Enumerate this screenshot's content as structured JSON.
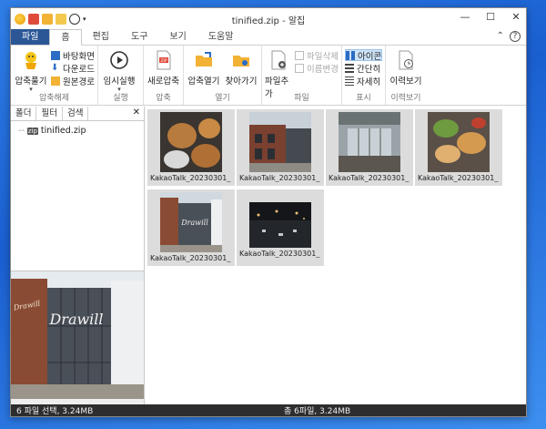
{
  "window": {
    "title": "tinified.zip - 알집"
  },
  "ribbon_tabs": [
    "파일",
    "홈",
    "편집",
    "도구",
    "보기",
    "도움말"
  ],
  "ribbon": {
    "extract": {
      "big_label": "압축풀기",
      "small": [
        "바탕화면",
        "다운로드",
        "원본경로"
      ],
      "group_label": "압축해제"
    },
    "run": {
      "big_label": "임시실행",
      "group_label": "실행"
    },
    "compress": {
      "big_label": "새로압축",
      "group_label": "압축"
    },
    "open": {
      "big1": "압축열기",
      "big2": "찾아가기",
      "group_label": "열기"
    },
    "file": {
      "big_label": "파일추가",
      "small": [
        "파일삭제",
        "이름변경"
      ],
      "group_label": "파일"
    },
    "view": {
      "small": [
        "아이콘",
        "간단히",
        "자세히"
      ],
      "group_label": "표시"
    },
    "history": {
      "big_label": "이력보기",
      "group_label": "이력보기"
    }
  },
  "left_tabs": [
    "폴더",
    "필터",
    "검색"
  ],
  "tree": {
    "root": "tinified.zip",
    "zip_tag": "zip"
  },
  "files": [
    {
      "name": "KakaoTalk_20230301_"
    },
    {
      "name": "KakaoTalk_20230301_"
    },
    {
      "name": "KakaoTalk_20230301_"
    },
    {
      "name": "KakaoTalk_20230301_"
    },
    {
      "name": "KakaoTalk_20230301_"
    },
    {
      "name": "KakaoTalk_20230301_"
    }
  ],
  "status": {
    "left": "6 파일 선택, 3.24MB",
    "center": "총 6파일, 3.24MB"
  },
  "preview_sign": "Drawill"
}
